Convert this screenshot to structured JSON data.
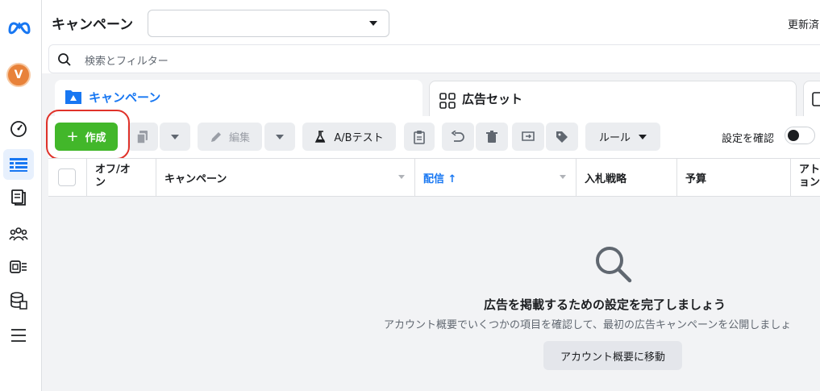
{
  "header": {
    "title": "キャンペーン",
    "campaign_select_value": "",
    "update_text": "更新済"
  },
  "search": {
    "placeholder": "検索とフィルター"
  },
  "tabs": [
    {
      "label": "キャンペーン",
      "icon": "folder-icon",
      "active": true
    },
    {
      "label": "広告セット",
      "icon": "grid-icon",
      "active": false
    },
    {
      "label": "",
      "icon": "ad-icon",
      "active": false
    }
  ],
  "toolbar": {
    "create_label": "作成",
    "edit_label": "編集",
    "ab_test_label": "A/Bテスト",
    "rules_label": "ルール",
    "review_settings_label": "設定を確認"
  },
  "table": {
    "columns": [
      {
        "label": "オフ/オン"
      },
      {
        "label": "キャンペーン"
      },
      {
        "label": "配信 ↑"
      },
      {
        "label": "入札戦略"
      },
      {
        "label": "予算"
      },
      {
        "label": "アトリビューション"
      }
    ],
    "col0_line1": "オフ/オ",
    "col0_line2": "ン",
    "col5_line1": "アト",
    "col5_line2": "ョン"
  },
  "empty_state": {
    "title": "広告を掲載するための設定を完了しましょう",
    "description": "アカウント概要でいくつかの項目を確認して、最初の広告キャンペーンを公開しましょ",
    "button_label": "アカウント概要に移動"
  },
  "sidebar": {
    "avatar_initial": "V",
    "items": [
      "dashboard-icon",
      "campaigns-table-icon",
      "ad-pages-icon",
      "audiences-icon",
      "ads-list-icon",
      "billing-stack-icon",
      "menu-icon"
    ]
  },
  "colors": {
    "brand_blue": "#1877f2",
    "create_green": "#42b72a",
    "highlight_red": "#e0322a",
    "avatar_orange": "#e8823a"
  }
}
